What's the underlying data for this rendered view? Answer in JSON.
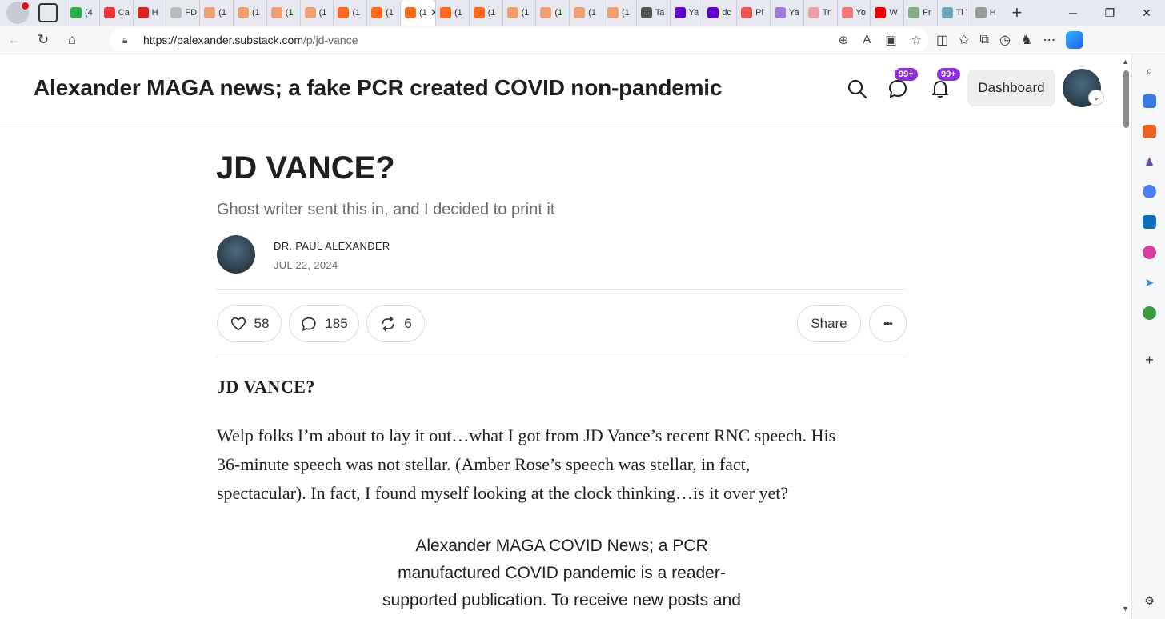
{
  "browser": {
    "tabs": [
      {
        "text": "(4",
        "color": "#2ab04a"
      },
      {
        "text": "Ca",
        "color": "#e33"
      },
      {
        "text": "H",
        "color": "#d22"
      },
      {
        "text": "FD",
        "color": "#bbb"
      },
      {
        "text": "(1",
        "color": "#f0a070"
      },
      {
        "text": "(1",
        "color": "#f0a070"
      },
      {
        "text": "(1",
        "color": "#f0a070"
      },
      {
        "text": "(1",
        "color": "#f0a070"
      },
      {
        "text": "(1",
        "color": "#ff6719"
      },
      {
        "text": "(1",
        "color": "#ff6719"
      },
      {
        "text": "(1",
        "color": "#ff6719",
        "active": true
      },
      {
        "text": "(1",
        "color": "#ff6719"
      },
      {
        "text": "(1",
        "color": "#ff6719"
      },
      {
        "text": "(1",
        "color": "#f0a070"
      },
      {
        "text": "(1",
        "color": "#f0a070"
      },
      {
        "text": "(1",
        "color": "#f0a070"
      },
      {
        "text": "(1",
        "color": "#f0a070"
      },
      {
        "text": "Ta",
        "color": "#555"
      },
      {
        "text": "Ya",
        "color": "#6001d2"
      },
      {
        "text": "dc",
        "color": "#6001d2"
      },
      {
        "text": "Pi",
        "color": "#e55"
      },
      {
        "text": "Ya",
        "color": "#a07ad8"
      },
      {
        "text": "Tr",
        "color": "#e8a0a0"
      },
      {
        "text": "Yo",
        "color": "#e77"
      },
      {
        "text": "W",
        "color": "#e00"
      },
      {
        "text": "Fr",
        "color": "#8a8"
      },
      {
        "text": "Ti",
        "color": "#6ab"
      },
      {
        "text": "H",
        "color": "#999"
      }
    ],
    "active_tab_close": "✕",
    "new_tab": "+",
    "url_host": "https://palexander.substack.com",
    "url_path": "/p/jd-vance"
  },
  "header": {
    "site_title": "Alexander MAGA news; a fake PCR created COVID non-pandemic",
    "chat_badge": "99+",
    "notif_badge": "99+",
    "dashboard_label": "Dashboard",
    "badge_color": "#8e2de2"
  },
  "post": {
    "title": "JD VANCE?",
    "subtitle": "Ghost writer sent this in, and I decided to print it",
    "author": "DR. PAUL ALEXANDER",
    "date": "JUL 22, 2024",
    "likes": "58",
    "comments": "185",
    "restacks": "6",
    "share_label": "Share",
    "more_label": "•••",
    "section_heading": "JD VANCE?",
    "paragraph_lines": [
      "Welp folks I’m about to lay it out…what I got from JD Vance’s recent RNC speech.  His",
      "36-minute speech was not stellar.  (Amber Rose’s speech was stellar, in fact,",
      "spectacular).  In fact, I found myself looking at the clock thinking…is it over yet?"
    ],
    "subscribe_lines": [
      "Alexander MAGA COVID News; a PCR",
      "manufactured COVID pandemic is a reader-",
      "supported publication. To receive new posts and"
    ]
  }
}
